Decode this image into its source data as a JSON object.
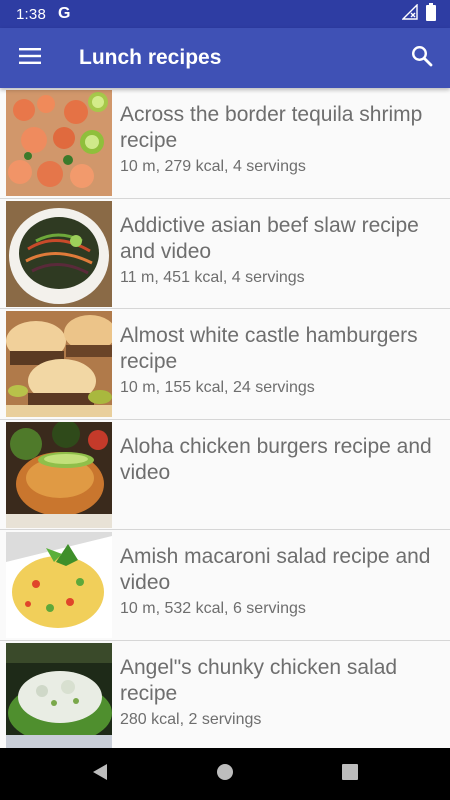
{
  "status_bar": {
    "time": "1:38",
    "notification_app": "G"
  },
  "app_bar": {
    "title": "Lunch recipes",
    "menu_icon": "hamburger-menu-icon",
    "search_icon": "search-icon"
  },
  "recipes": [
    {
      "title": "Across the border tequila shrimp recipe",
      "meta": "10 m, 279 kcal, 4 servings"
    },
    {
      "title": "Addictive asian beef slaw  recipe and video",
      "meta": "11 m, 451 kcal, 4 servings"
    },
    {
      "title": "Almost white castle hamburgers recipe",
      "meta": "10 m, 155 kcal, 24 servings"
    },
    {
      "title": "Aloha chicken burgers recipe and video",
      "meta": ""
    },
    {
      "title": "Amish macaroni salad recipe and video",
      "meta": "10 m, 532 kcal, 6 servings"
    },
    {
      "title": "Angel\"s chunky chicken salad recipe",
      "meta": "280 kcal, 2 servings"
    }
  ],
  "colors": {
    "status_bar": "#2e3da3",
    "app_bar": "#3f51b5",
    "text": "#6e6e6e",
    "background": "#fafafa"
  }
}
